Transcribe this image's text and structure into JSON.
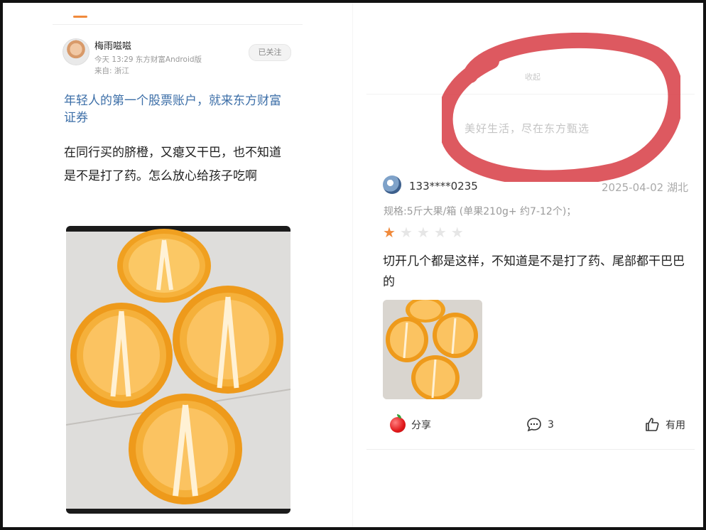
{
  "left_post": {
    "author": "梅雨嗞嗞",
    "meta_line": "今天 13:29 东方财富Android版",
    "location": "来自: 浙江",
    "follow_label": "已关注",
    "promo_link": "年轻人的第一个股票账户，就来东方财富证券",
    "body": "在同行买的脐橙，又瘪又干巴，也不知道是不是打了药。怎么放心给孩子吃啊"
  },
  "right_review": {
    "faded_text": "收起",
    "slogan": "美好生活，尽在东方甄选",
    "user": "133****0235",
    "date": "2025-04-02  湖北",
    "spec": "规格:5斤大果/箱 (单果210g+ 约7-12个)；",
    "rating": 1,
    "rating_max": 5,
    "text": "切开几个都是这样，不知道是不是打了药、尾部都干巴巴的",
    "actions": {
      "share": "分享",
      "comments": "3",
      "useful": "有用"
    }
  },
  "colors": {
    "link": "#3d6fa8",
    "annotation_circle": "#d9474f",
    "star_active": "#f08a3c",
    "star_inactive": "#e6e6e6",
    "tab_accent": "#f08a3c"
  },
  "icons": [
    "apple-icon",
    "comment-icon",
    "thumbs-up-icon",
    "star-icon"
  ]
}
